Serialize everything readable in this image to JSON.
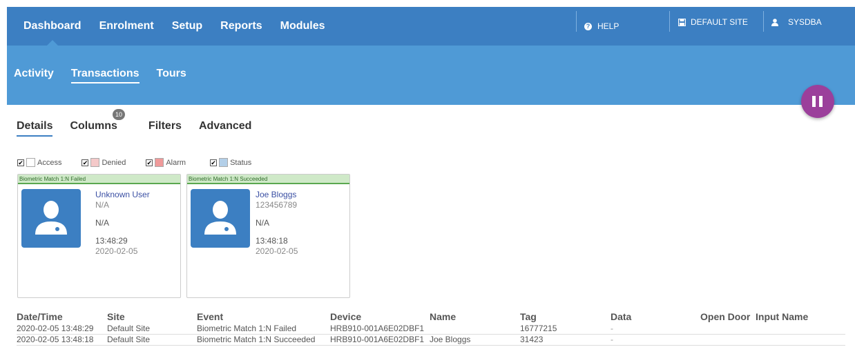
{
  "topnav": {
    "items": [
      "Dashboard",
      "Enrolment",
      "Setup",
      "Reports",
      "Modules"
    ],
    "help_label": "HELP",
    "site_label": "DEFAULT SITE",
    "user_label": "SYSDBA"
  },
  "subnav": {
    "items": [
      "Activity",
      "Transactions",
      "Tours"
    ]
  },
  "tabs": {
    "items": [
      "Details",
      "Columns",
      "Filters",
      "Advanced"
    ],
    "columns_badge": "10"
  },
  "filters": [
    {
      "label": "Access",
      "checked": true,
      "color": "#ffffff"
    },
    {
      "label": "Denied",
      "checked": true,
      "color": "#f4c9c9"
    },
    {
      "label": "Alarm",
      "checked": true,
      "color": "#ef9a9a"
    },
    {
      "label": "Status",
      "checked": true,
      "color": "#b3cfe8"
    }
  ],
  "cards": [
    {
      "event": "Biometric Match 1:N Failed",
      "name": "Unknown User",
      "id": "N/A",
      "field": "N/A",
      "time": "13:48:29",
      "date": "2020-02-05"
    },
    {
      "event": "Biometric Match 1:N Succeeded",
      "name": "Joe Bloggs",
      "id": "123456789",
      "field": "N/A",
      "time": "13:48:18",
      "date": "2020-02-05"
    }
  ],
  "table": {
    "headers": {
      "datetime": "Date/Time",
      "site": "Site",
      "event": "Event",
      "device": "Device",
      "name": "Name",
      "tag": "Tag",
      "data": "Data",
      "opendoor": "Open Door",
      "inputname": "Input Name"
    },
    "rows": [
      {
        "datetime": "2020-02-05 13:48:29",
        "site": "Default Site",
        "event": "Biometric Match 1:N Failed",
        "device": "HRB910-001A6E02DBF1",
        "name": "",
        "tag": "16777215",
        "data": "-"
      },
      {
        "datetime": "2020-02-05 13:48:18",
        "site": "Default Site",
        "event": "Biometric Match 1:N Succeeded",
        "device": "HRB910-001A6E02DBF1",
        "name": "Joe Bloggs",
        "tag": "31423",
        "data": "-"
      }
    ]
  },
  "colors": {
    "top_bar": "#3c7fc2",
    "sub_bar": "#4f9ad6",
    "pause_button": "#9b3f9b",
    "card_header": "#cfe9c8"
  }
}
